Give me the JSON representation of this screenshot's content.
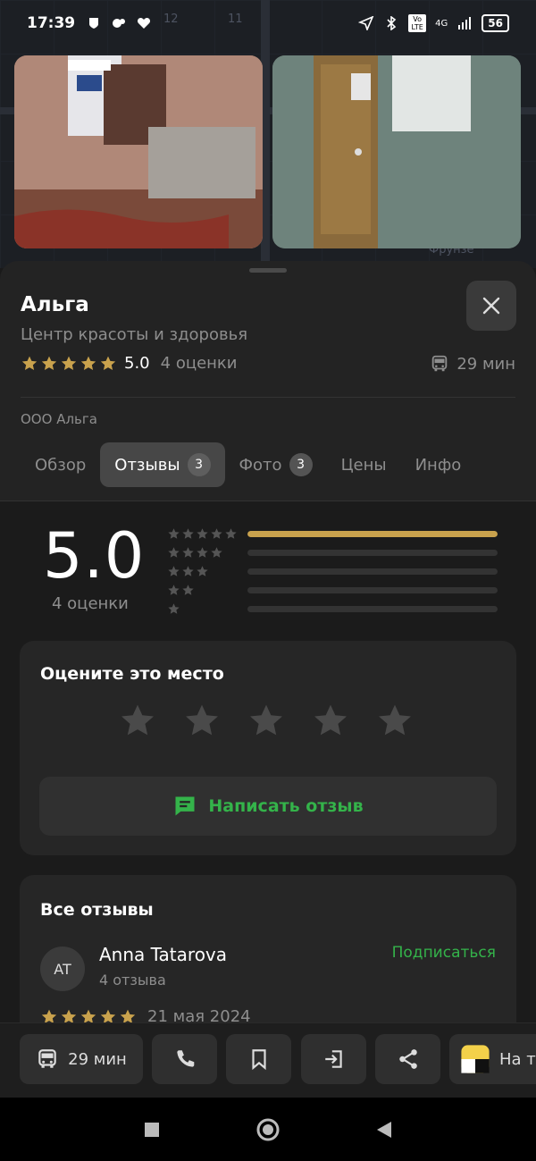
{
  "status_bar": {
    "time": "17:39",
    "network": "4G",
    "volte": "Vo LTE",
    "battery": "56"
  },
  "map": {
    "labels": [
      "12",
      "11",
      "Фрунзе"
    ]
  },
  "place": {
    "name": "Альга",
    "category": "Центр красоты и здоровья",
    "rating": "5.0",
    "rating_count": "4 оценки",
    "transit_time": "29 мин",
    "company": "ООО Альга"
  },
  "tabs": [
    {
      "label": "Обзор",
      "badge": ""
    },
    {
      "label": "Отзывы",
      "badge": "3"
    },
    {
      "label": "Фото",
      "badge": "3"
    },
    {
      "label": "Цены",
      "badge": ""
    },
    {
      "label": "Инфо",
      "badge": ""
    }
  ],
  "rating_summary": {
    "value": "5.0",
    "count": "4 оценки",
    "distribution": [
      {
        "stars": 5,
        "fraction": 1.0
      },
      {
        "stars": 4,
        "fraction": 0.0
      },
      {
        "stars": 3,
        "fraction": 0.0
      },
      {
        "stars": 2,
        "fraction": 0.0
      },
      {
        "stars": 1,
        "fraction": 0.0
      }
    ]
  },
  "rate_card": {
    "title": "Оцените это место",
    "write_label": "Написать отзыв"
  },
  "reviews": {
    "title": "Все отзывы",
    "items": [
      {
        "initials": "AT",
        "name": "Anna Tatarova",
        "count": "4 отзыва",
        "subscribe": "Подписаться",
        "date": "21 мая 2024",
        "stars": 5
      }
    ]
  },
  "actions": {
    "route_time": "29 мин",
    "taxi_label": "На т"
  },
  "colors": {
    "accent_green": "#34b34a",
    "star_gold": "#c9a24d",
    "background": "#1b1b1b"
  },
  "icons": [
    "bus-icon",
    "close-icon",
    "phone-icon",
    "bookmark-icon",
    "enter-icon",
    "share-icon",
    "taxi-icon",
    "message-icon"
  ]
}
